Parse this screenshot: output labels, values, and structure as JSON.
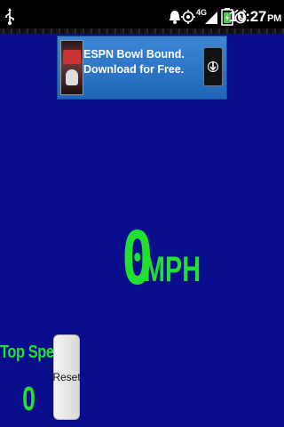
{
  "status_bar": {
    "time": "10:27",
    "time_suffix": "PM",
    "network": "4G",
    "icons": [
      "usb-icon",
      "alarm-icon",
      "gps-icon",
      "network-4g-icon",
      "battery-icon",
      "clock-alarm-icon"
    ]
  },
  "ad": {
    "text": "ESPN Bowl Bound. Download for Free.",
    "colors": {
      "background": "#2a74c8",
      "text": "#ffffff"
    },
    "icon": "download-arrow-icon"
  },
  "speedometer": {
    "value": "0",
    "unit": "MPH",
    "color": "#21e02f"
  },
  "top_speed": {
    "label": "Top Speed",
    "value": "0"
  },
  "reset_button": {
    "label": "Reset"
  },
  "colors": {
    "background": "#0a0e8c",
    "accent": "#21e02f"
  }
}
